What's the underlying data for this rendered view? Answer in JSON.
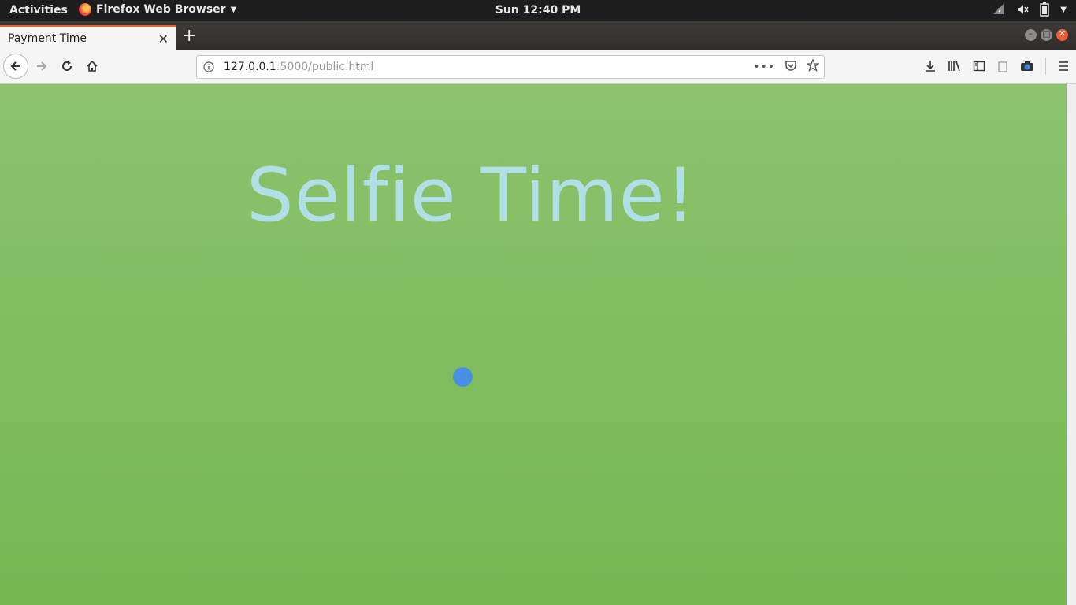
{
  "system_bar": {
    "activities": "Activities",
    "app_name": "Firefox Web Browser",
    "clock": "Sun 12:40 PM",
    "tray_icons": [
      "network-question-icon",
      "volume-muted-icon",
      "battery-icon",
      "system-menu-caret-icon"
    ]
  },
  "browser": {
    "tab_title": "Payment Time",
    "url_host": "127.0.0.1",
    "url_path": ":5000/public.html",
    "toolbar_icons": [
      "download-icon",
      "library-icon",
      "sidebar-icon",
      "screenshot-icon",
      "menu-icon"
    ]
  },
  "page": {
    "headline": "Selfie Time!",
    "colors": {
      "background_top": "#8cc26e",
      "background_bottom": "#76b852",
      "headline": "#b0e0e6",
      "dot": "#4a90e2"
    }
  }
}
